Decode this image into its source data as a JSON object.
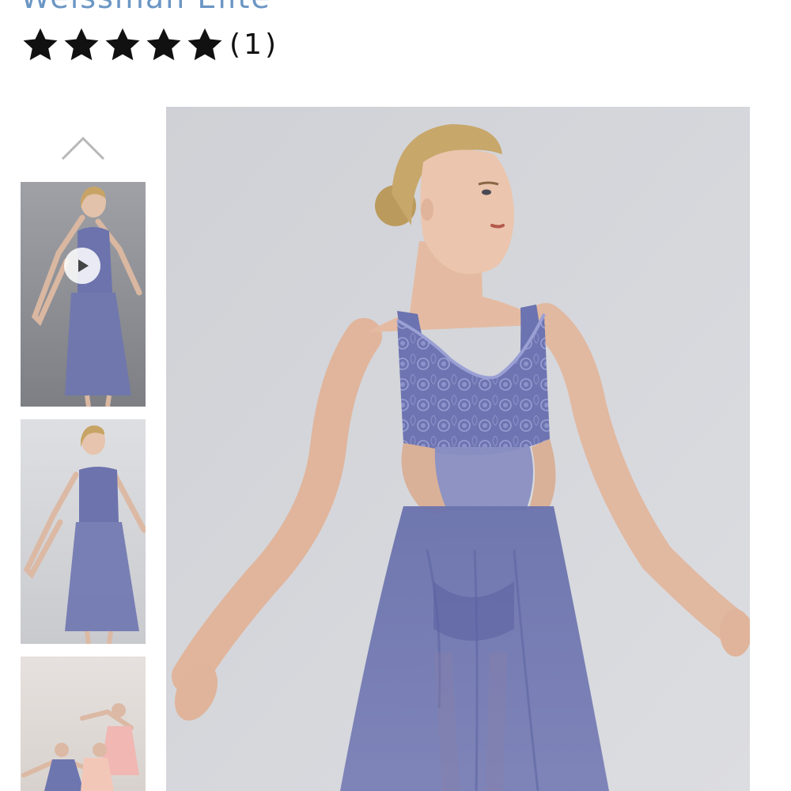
{
  "product": {
    "brand": "Weissman Elite",
    "rating": {
      "stars": 5,
      "count_label": "(1)"
    }
  },
  "gallery": {
    "up_icon": "chevron-up-icon",
    "thumbnails": [
      {
        "kind": "video",
        "icon": "play-icon"
      },
      {
        "kind": "image"
      },
      {
        "kind": "image"
      }
    ]
  },
  "colors": {
    "brand_text": "#6b96c4",
    "dress": "#6e76b0",
    "backdrop": "#d5d7dc"
  }
}
